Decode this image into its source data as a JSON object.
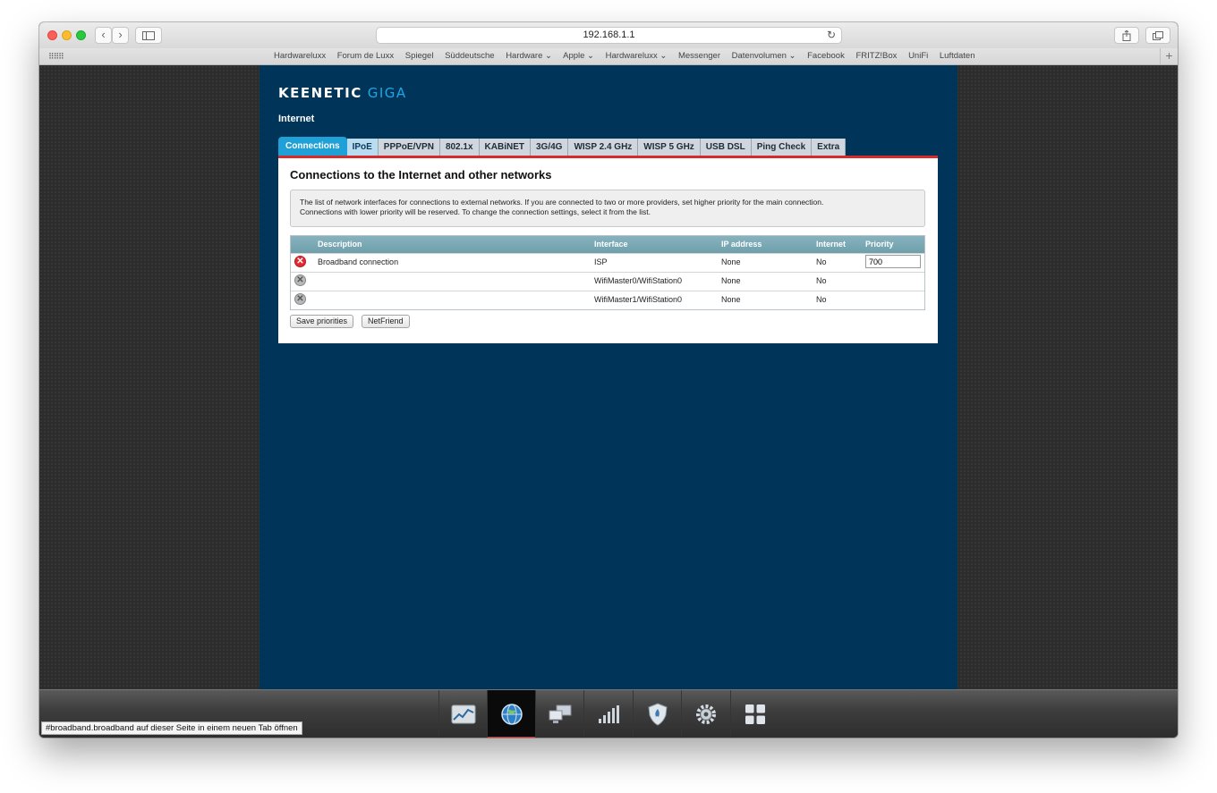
{
  "browser": {
    "url": "192.168.1.1",
    "nav_back": "‹",
    "nav_forward": "›",
    "reload_icon": "↻",
    "favorites_grid": "⠿⠿⠿",
    "favorites_plus": "+",
    "favorites": [
      "Hardwareluxx",
      "Forum de Luxx",
      "Spiegel",
      "Süddeutsche",
      "Hardware ⌄",
      "Apple ⌄",
      "Hardwareluxx ⌄",
      "Messenger",
      "Datenvolumen ⌄",
      "Facebook",
      "FRITZ!Box",
      "UniFi",
      "Luftdaten"
    ]
  },
  "router": {
    "brand": "KEENETIC",
    "model": "GIGA",
    "section": "Internet"
  },
  "tabs": [
    "Connections",
    "IPoE",
    "PPPoE/VPN",
    "802.1x",
    "KABiNET",
    "3G/4G",
    "WISP 2.4 GHz",
    "WISP 5 GHz",
    "USB DSL",
    "Ping Check",
    "Extra"
  ],
  "content": {
    "title": "Connections to the Internet and other networks",
    "info_line1": "The list of network interfaces for connections to external networks. If you are connected to two or more providers, set higher priority for the main connection.",
    "info_line2": "Connections with lower priority will be reserved. To change the connection settings, select it from the list.",
    "columns": {
      "description": "Description",
      "interface": "Interface",
      "ip": "IP address",
      "internet": "Internet",
      "priority": "Priority"
    },
    "rows": [
      {
        "status": "error",
        "description": "Broadband connection",
        "interface": "ISP",
        "ip": "None",
        "internet": "No",
        "priority": "700"
      },
      {
        "status": "disabled",
        "description": "",
        "interface": "WifiMaster0/WifiStation0",
        "ip": "None",
        "internet": "No",
        "priority": ""
      },
      {
        "status": "disabled",
        "description": "",
        "interface": "WifiMaster1/WifiStation0",
        "ip": "None",
        "internet": "No",
        "priority": ""
      }
    ],
    "save_button": "Save priorities",
    "netfriend_button": "NetFriend"
  },
  "dock": {
    "items": [
      "dashboard-icon",
      "internet-globe-icon",
      "home-network-icon",
      "wifi-signal-icon",
      "security-shield-icon",
      "settings-gear-icon",
      "apps-grid-icon"
    ],
    "active": "internet-globe-icon"
  },
  "status_tip": "#broadband.broadband auf dieser Seite in einem neuen Tab öffnen",
  "colors": {
    "panel": "#003559",
    "accent_red": "#d52b2b",
    "tab_active": "#1fa0d6",
    "brand_blue": "#19a9e8"
  }
}
